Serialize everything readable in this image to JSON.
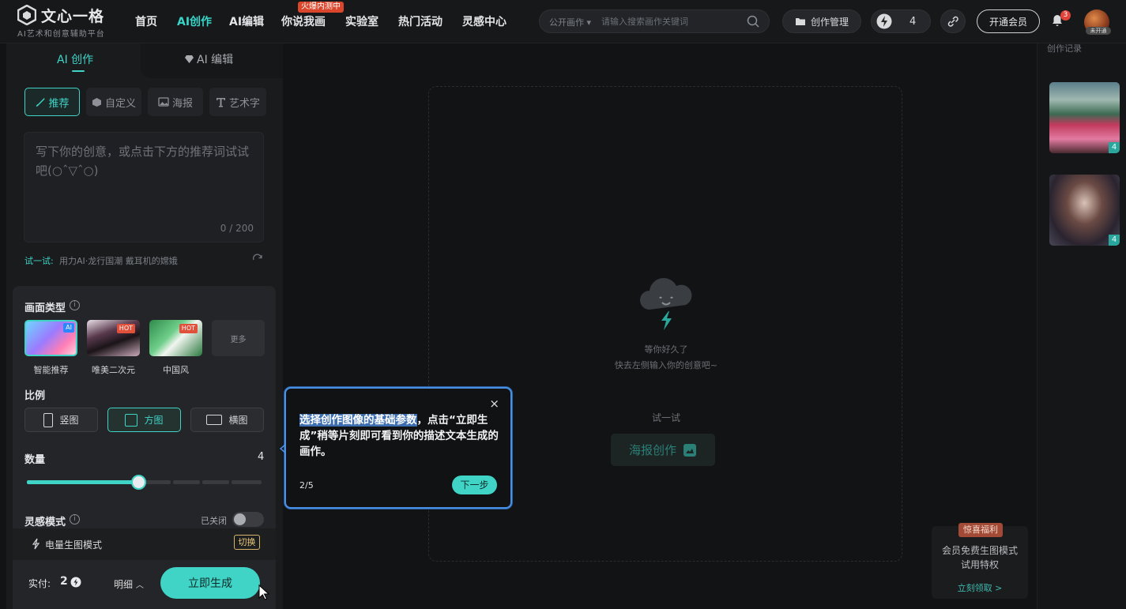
{
  "header": {
    "logo_text": "文心一格",
    "logo_sub": "AI艺术和创意辅助平台",
    "nav": [
      {
        "label": "首页"
      },
      {
        "label": "AI创作"
      },
      {
        "label": "AI编辑"
      },
      {
        "label": "你说我画"
      },
      {
        "label": "实验室"
      },
      {
        "label": "热门活动"
      },
      {
        "label": "灵感中心"
      }
    ],
    "hot_badge": "火爆内测中",
    "search": {
      "scope": "公开画作 ▾",
      "placeholder": "请输入搜索画作关键词"
    },
    "manage_label": "创作管理",
    "energy_count": "4",
    "vip_label": "开通会员",
    "notif_count": "3",
    "avatar_tag": "未开通"
  },
  "left": {
    "tabs": [
      {
        "label": "AI 创作"
      },
      {
        "label": "AI 编辑"
      }
    ],
    "modes": [
      {
        "label": "推荐"
      },
      {
        "label": "自定义"
      },
      {
        "label": "海报"
      },
      {
        "label": "艺术字"
      }
    ],
    "prompt_placeholder": "写下你的创意，或点击下方的推荐词试试吧(○ˆ▽ˆ○)",
    "prompt_count": "0 / 200",
    "try_label": "试一试:",
    "try_items": "用力AI·龙行国潮  戴耳机的嫦娥"
  },
  "params": {
    "type_title": "画面类型",
    "types": [
      {
        "label": "智能推荐",
        "tag": "AI"
      },
      {
        "label": "唯美二次元",
        "tag": "HOT"
      },
      {
        "label": "中国风",
        "tag": "HOT"
      },
      {
        "label": "更多",
        "tag": ""
      }
    ],
    "ratio_title": "比例",
    "ratios": [
      {
        "label": "竖图"
      },
      {
        "label": "方图"
      },
      {
        "label": "横图"
      }
    ],
    "qty_title": "数量",
    "qty_value": "4",
    "qty_max": 8,
    "inspire_title": "灵感模式",
    "inspire_state": "已关闭",
    "power_mode": "电量生图模式",
    "switch_label": "切换",
    "pay_label": "实付:",
    "pay_value": "2",
    "detail_label": "明细",
    "generate_label": "立即生成"
  },
  "canvas": {
    "empty_line1": "等你好久了",
    "empty_line2": "快去左侧输入你的创意吧~",
    "try_label": "试一试",
    "poster_label": "海报创作"
  },
  "tooltip": {
    "highlight": "选择创作图像的基础参数",
    "text": "，点击“立即生成”稍等片刻即可看到你的描述文本生成的画作。",
    "step": "2/5",
    "next_label": "下一步",
    "close": "×"
  },
  "right": {
    "history_label": "创作记录",
    "items": [
      {
        "count": "4"
      },
      {
        "count": "4"
      }
    ]
  },
  "promo": {
    "tag": "惊喜福利",
    "line1": "会员免费生图模式",
    "line2": "试用特权",
    "link": "立刻领取 >"
  },
  "colors": {
    "accent": "#3fd4c6",
    "tooltip_border": "#4a90e2",
    "hot": "#e0503a",
    "badge": "#e0433a"
  }
}
